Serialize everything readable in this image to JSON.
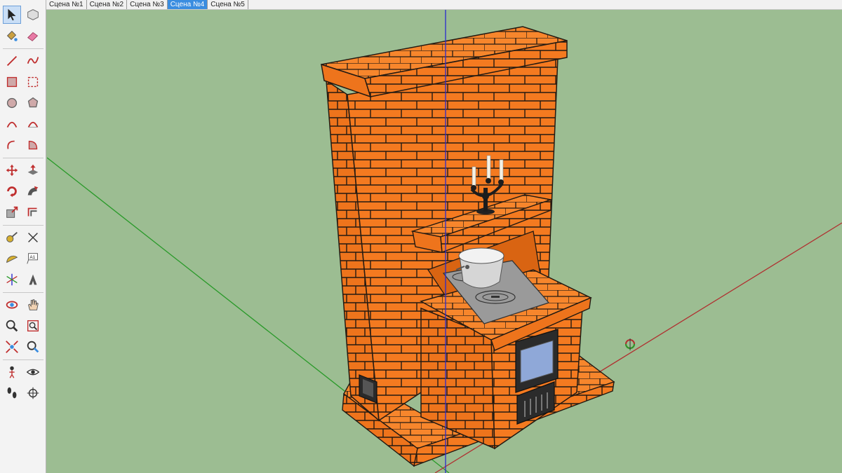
{
  "scene_tabs": [
    {
      "label": "Сцена №1",
      "active": false
    },
    {
      "label": "Сцена №2",
      "active": false
    },
    {
      "label": "Сцена №3",
      "active": false
    },
    {
      "label": "Сцена №4",
      "active": true
    },
    {
      "label": "Сцена №5",
      "active": false
    }
  ],
  "tools": [
    {
      "name": "select-tool-icon",
      "active": true
    },
    {
      "name": "make-component-icon"
    },
    {
      "name": "paint-bucket-icon"
    },
    {
      "name": "eraser-icon"
    },
    {
      "name": "line-tool-icon"
    },
    {
      "name": "freehand-tool-icon"
    },
    {
      "name": "rectangle-tool-icon"
    },
    {
      "name": "rotated-rectangle-icon"
    },
    {
      "name": "circle-tool-icon"
    },
    {
      "name": "polygon-tool-icon"
    },
    {
      "name": "arc-tool-icon"
    },
    {
      "name": "two-point-arc-icon"
    },
    {
      "name": "three-point-arc-icon"
    },
    {
      "name": "pie-tool-icon"
    },
    {
      "name": "move-tool-icon"
    },
    {
      "name": "push-pull-icon"
    },
    {
      "name": "rotate-tool-icon"
    },
    {
      "name": "follow-me-icon"
    },
    {
      "name": "scale-tool-icon"
    },
    {
      "name": "offset-tool-icon"
    },
    {
      "name": "tape-measure-icon"
    },
    {
      "name": "dimension-tool-icon"
    },
    {
      "name": "protractor-icon"
    },
    {
      "name": "text-tool-icon",
      "label": "A1"
    },
    {
      "name": "axes-tool-icon"
    },
    {
      "name": "3d-text-icon"
    },
    {
      "name": "orbit-tool-icon"
    },
    {
      "name": "pan-tool-icon"
    },
    {
      "name": "zoom-tool-icon"
    },
    {
      "name": "zoom-window-icon"
    },
    {
      "name": "zoom-extents-icon"
    },
    {
      "name": "previous-view-icon"
    },
    {
      "name": "position-camera-icon"
    },
    {
      "name": "look-around-icon"
    },
    {
      "name": "walk-tool-icon"
    },
    {
      "name": "section-plane-icon"
    }
  ],
  "colors": {
    "ground": "#9cbd92",
    "brick": "#f47a20",
    "brick_dark": "#e06a12",
    "mortar": "#222222",
    "axis_red": "#c03030",
    "axis_green": "#2a9a2a",
    "axis_blue": "#2a2ad0",
    "tab_active": "#3a8de0"
  }
}
